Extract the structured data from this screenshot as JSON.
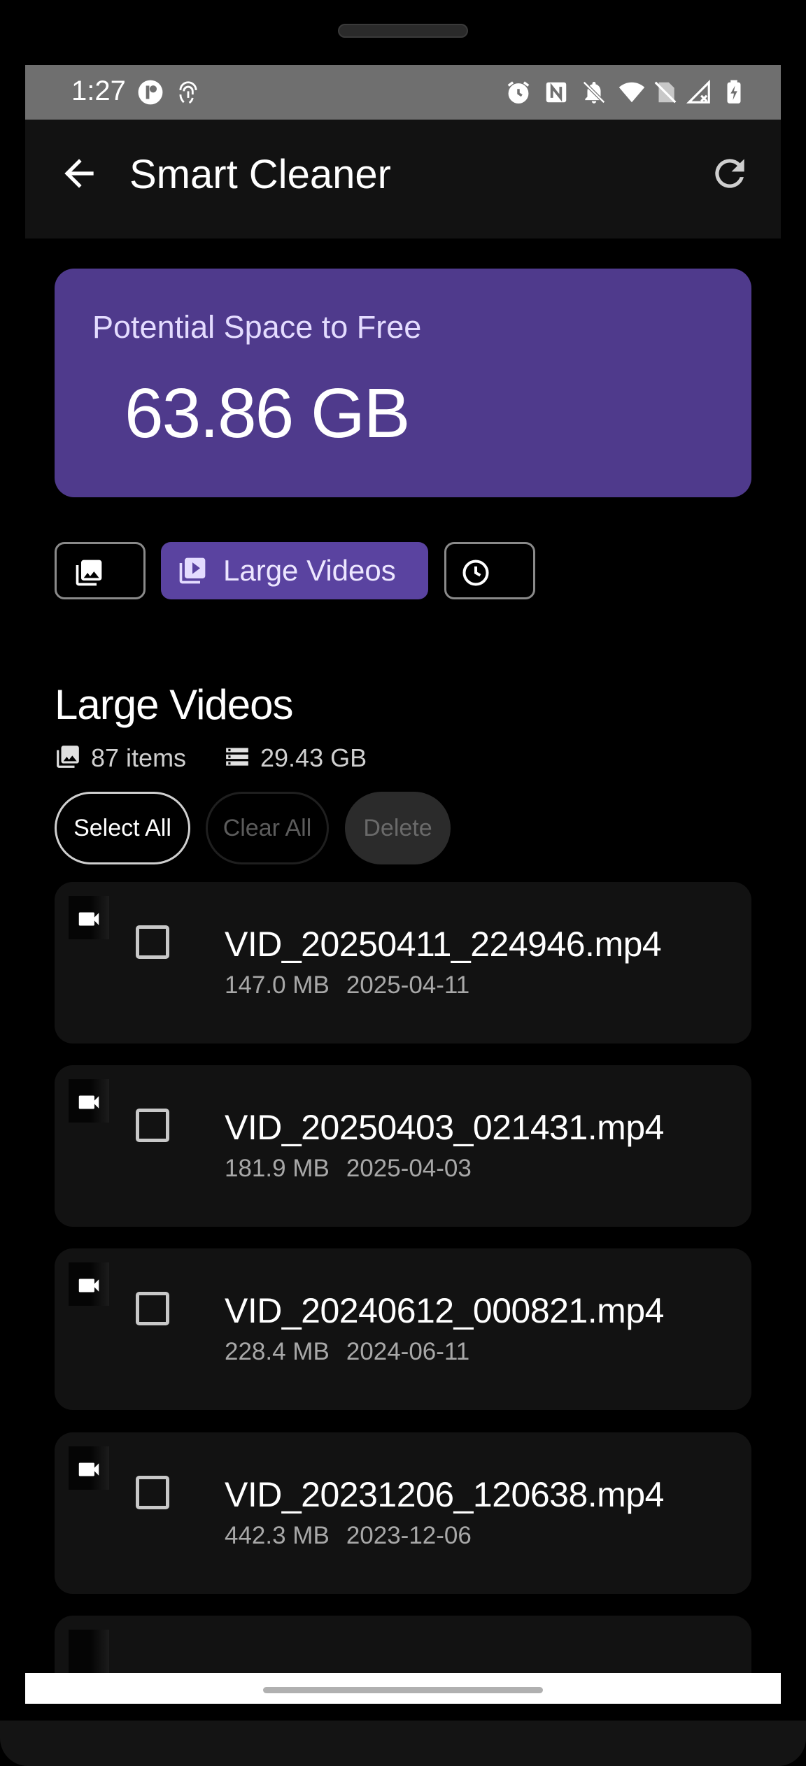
{
  "status_bar": {
    "time": "1:27",
    "left_icons": [
      "app-notification-icon",
      "fingerprint-icon"
    ],
    "right_icons": [
      "alarm-icon",
      "nfc-icon",
      "mute-icon",
      "wifi-icon",
      "no-sim-icon",
      "signal-off-icon",
      "battery-charging-icon"
    ]
  },
  "app_bar": {
    "title": "Smart Cleaner",
    "back_icon": "arrow-back-icon",
    "refresh_icon": "refresh-icon"
  },
  "summary": {
    "label": "Potential Space to Free",
    "value": "63.86 GB",
    "accent_color": "#4f3a8c"
  },
  "filters": [
    {
      "icon": "photo-library-icon",
      "label": "",
      "selected": false
    },
    {
      "icon": "video-library-icon",
      "label": "Large Videos",
      "selected": true
    },
    {
      "icon": "clock-icon",
      "label": "",
      "selected": false
    }
  ],
  "section": {
    "title": "Large Videos",
    "item_count": "87 items",
    "total_size": "29.43 GB"
  },
  "actions": {
    "select_all": "Select All",
    "clear_all": "Clear All",
    "delete": "Delete"
  },
  "items": [
    {
      "name": "VID_20250411_224946.mp4",
      "size": "147.0 MB",
      "date": "2025-04-11",
      "checked": false
    },
    {
      "name": "VID_20250403_021431.mp4",
      "size": "181.9 MB",
      "date": "2025-04-03",
      "checked": false
    },
    {
      "name": "VID_20240612_000821.mp4",
      "size": "228.4 MB",
      "date": "2024-06-11",
      "checked": false
    },
    {
      "name": "VID_20231206_120638.mp4",
      "size": "442.3 MB",
      "date": "2023-12-06",
      "checked": false
    }
  ]
}
